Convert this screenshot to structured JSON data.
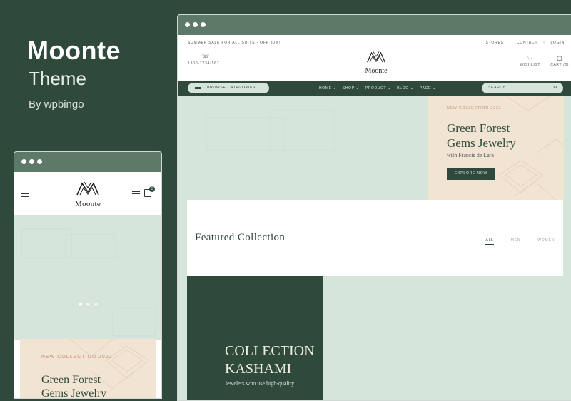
{
  "promo": {
    "title": "Moonte",
    "subtitle": "Theme",
    "byline": "By wpbingo"
  },
  "mobile": {
    "logo": "Moonte",
    "cart_count": "0",
    "card_tag": "NEW COLLECTION 2022",
    "card_title_1": "Green Forest",
    "card_title_2": "Gems Jewelry"
  },
  "desktop": {
    "sale_text": "SUMMER SALE FOR ALL SUITS - OFF 30%!",
    "top_links": [
      "STORES",
      "CONTACT",
      "LOGIN"
    ],
    "phone": "1800-1234-567",
    "logo": "Moonte",
    "wishlist_label": "WISHLIST",
    "cart_label": "CART (0)",
    "browse_label": "BROWSE CATEGORIES",
    "nav": [
      "HOME",
      "SHOP",
      "PRODUCT",
      "BLOG",
      "PAGE"
    ],
    "search_placeholder": "SEARCH",
    "hero": {
      "tag": "NEW COLLECTION 2022",
      "title_1": "Green Forest",
      "title_2": "Gems Jewelry",
      "subtitle": "with Francis de Lara",
      "button": "EXPLORE NOW"
    },
    "featured": {
      "title": "Featured Collection",
      "tabs": [
        "ALL",
        "MEN",
        "WOMEN"
      ]
    },
    "kashami": {
      "title_1": "COLLECTION",
      "title_2": "KASHAMI",
      "subtitle": "Jewelers who use high-quality"
    }
  },
  "colors": {
    "background": "#2f4a3b",
    "accent_green": "#2f4a3b",
    "mint": "#d6e5da",
    "peach": "#f2e4d3",
    "tag_rose": "#c98b6e"
  }
}
